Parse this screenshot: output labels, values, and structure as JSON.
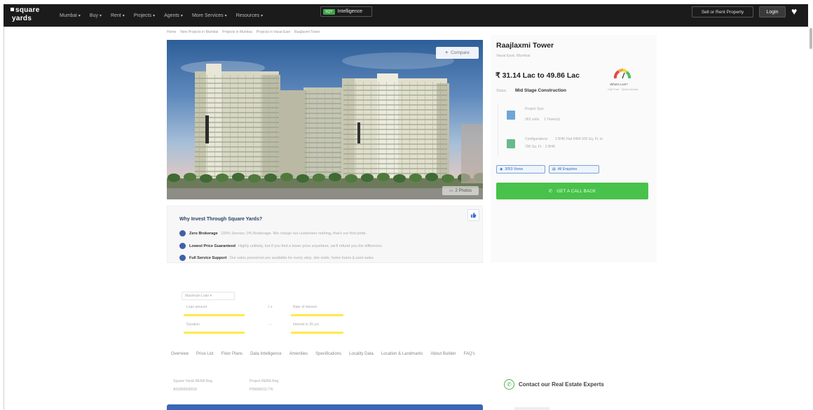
{
  "header": {
    "logo_line1": "square",
    "logo_line2": "yards",
    "nav": [
      {
        "label": "Mumbai"
      },
      {
        "label": "Buy"
      },
      {
        "label": "Rent"
      },
      {
        "label": "Projects"
      },
      {
        "label": "Agents"
      },
      {
        "label": "More Services"
      },
      {
        "label": "Resources"
      }
    ],
    "intel_badge": "SQY",
    "intel_label": "Intelligence",
    "sell_label": "Sell or Rent Property",
    "login_label": "Login"
  },
  "breadcrumb": [
    "Home",
    "New Projects in Mumbai",
    "Projects in Mumbai",
    "Projects in Vasai East",
    "Raajlaxmi Tower"
  ],
  "hero": {
    "compare_label": "Compare",
    "photos_label": "2 Photos"
  },
  "project": {
    "title": "Raajlaxmi Tower",
    "location": "Vasai East, Mumbai",
    "price": "₹ 31.14 Lac to 49.86 Lac",
    "status_label": "Status",
    "status_value": "Mid Stage Construction",
    "gauge_label": "What's Live?",
    "gauge_sub": "Call Free · Quick Access",
    "size_label": "Project Size",
    "size_value1": "363 units",
    "size_value2": "1 Tower(s)",
    "config_label": "Configurations",
    "config_value1": "1 BHK Flat 0484 500 Sq. Ft. to",
    "config_value2": "790 Sq. Ft. · 2 BHK",
    "views_chip": "3053 Views",
    "register_chip": "All Enquiries",
    "call_label": "GET A CALL BACK"
  },
  "why_invest": {
    "title": "Why Invest Through Square Yards?",
    "points": [
      {
        "key": "Zero Brokerage",
        "value": "100% Service, 0% Brokerage. We charge our customers nothing, that's our first pride."
      },
      {
        "key": "Lowest Price Guaranteed",
        "value": "Highly unlikely, but if you find a lower price anywhere, we'll refund you the difference."
      },
      {
        "key": "Full Service Support",
        "value": "Our sales personnel are available for every step, site visits, home loans & post sales."
      }
    ]
  },
  "calculator": {
    "select_label": "Maximum Loan ▾",
    "field1": "Loan amount",
    "field2": "Duration",
    "field3": "Rate of interest",
    "field4": "Interest in 20 yrs",
    "sep1": "1 ▾",
    "sep2": "—"
  },
  "tabs": [
    "Overview",
    "Price List",
    "Floor Plans",
    "Data Intelligence",
    "Amenities",
    "Specifications",
    "Locality Data",
    "Location & Landmarks",
    "About Builder",
    "FAQ's"
  ],
  "rera": {
    "label1": "Square Yards RERA Reg.",
    "value1": "A51800000018",
    "label2": "Project RERA Reg.",
    "value2": "P99000011776"
  },
  "contact_label": "Contact our Real Estate Experts",
  "colors": {
    "nav_bg": "#1b1b1b",
    "cta_green": "#48c24a",
    "accent_blue": "#3b66b8",
    "highlight_yellow": "#ffe94a"
  }
}
